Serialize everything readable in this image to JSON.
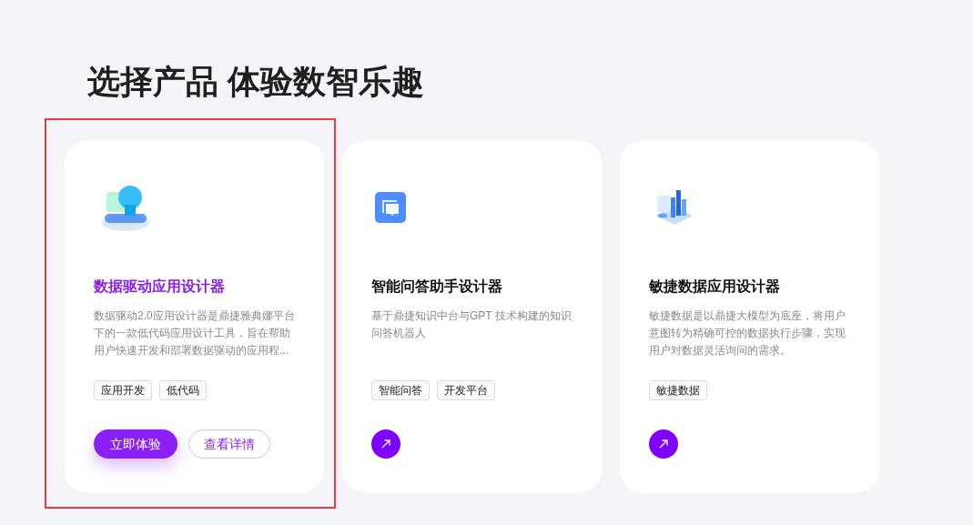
{
  "heading": "选择产品 体验数智乐趣",
  "cards": [
    {
      "title": "数据驱动应用设计器",
      "description": "数据驱动2.0应用设计器是鼎捷雅典娜平台下的一款低代码应用设计工具，旨在帮助用户快速开发和部署数据驱动的应用程...",
      "tags": [
        "应用开发",
        "低代码"
      ],
      "selected": true,
      "buttons": [
        {
          "label": "立即体验",
          "kind": "primary"
        },
        {
          "label": "查看详情",
          "kind": "outline"
        }
      ]
    },
    {
      "title": "智能问答助手设计器",
      "description": "基于鼎捷知识中台与GPT 技术构建的知识问答机器人",
      "tags": [
        "智能问答",
        "开发平台"
      ],
      "selected": false
    },
    {
      "title": "敏捷数据应用设计器",
      "description": "敏捷数据是以鼎捷大模型为底座，将用户意图转为精确可控的数据执行步骤，实现用户对数据灵活询问的需求。",
      "tags": [
        "敏捷数据"
      ],
      "selected": false
    }
  ]
}
